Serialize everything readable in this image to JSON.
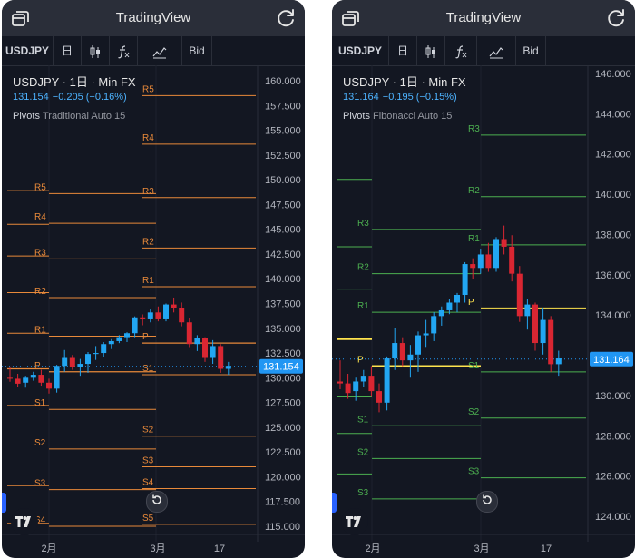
{
  "app": {
    "title": "TradingView"
  },
  "toolbar": {
    "symbol": "USDJPY",
    "interval": "日",
    "price_type": "Bid"
  },
  "colors": {
    "up": "#22a6f2",
    "down": "#d92632",
    "pivot_orange": "#e8893a",
    "pivot_green": "#4caf50",
    "pivot_yellow": "#ffe44d",
    "price_tag": "#2196f3",
    "bg": "#131722"
  },
  "icons": {
    "left": "window-switch-icon",
    "right": "refresh-icon",
    "candles": "candlestick-icon",
    "indicators": "function-fx-icon",
    "compare": "chart-line-icon"
  },
  "charts": [
    {
      "legend": {
        "symbol_line": "USDJPY · 1日 · Min FX",
        "price": "131.154",
        "change": "−0.205 (−0.16%)",
        "indicator_name": "Pivots",
        "indicator_args": "Traditional Auto 15"
      },
      "price_axis": {
        "ticks": [
          "160.000",
          "157.500",
          "155.000",
          "152.500",
          "150.000",
          "147.500",
          "145.000",
          "142.500",
          "140.000",
          "137.500",
          "135.000",
          "132.500",
          "130.000",
          "127.500",
          "125.000",
          "122.500",
          "120.000",
          "117.500",
          "115.000"
        ],
        "current_price": "131.154"
      },
      "time_axis": [
        "2月",
        "3月",
        "17"
      ],
      "pivot_labels": [
        "R5",
        "R4",
        "R3",
        "R2",
        "R1",
        "P",
        "S1",
        "S2",
        "S3",
        "S4",
        "S5"
      ],
      "ohlc": [
        {
          "o": 130.0,
          "h": 131.1,
          "l": 129.6,
          "c": 129.9
        },
        {
          "o": 129.9,
          "h": 130.4,
          "l": 129.1,
          "c": 129.4
        },
        {
          "o": 129.5,
          "h": 130.2,
          "l": 129.0,
          "c": 130.0
        },
        {
          "o": 130.0,
          "h": 130.6,
          "l": 129.7,
          "c": 130.3
        },
        {
          "o": 130.3,
          "h": 130.8,
          "l": 129.2,
          "c": 129.5
        },
        {
          "o": 129.5,
          "h": 129.9,
          "l": 128.4,
          "c": 128.9
        },
        {
          "o": 128.9,
          "h": 131.3,
          "l": 128.5,
          "c": 131.2
        },
        {
          "o": 131.2,
          "h": 132.8,
          "l": 130.6,
          "c": 132.0
        },
        {
          "o": 132.0,
          "h": 132.3,
          "l": 130.8,
          "c": 131.1
        },
        {
          "o": 131.1,
          "h": 131.9,
          "l": 130.2,
          "c": 131.4
        },
        {
          "o": 131.4,
          "h": 132.6,
          "l": 130.5,
          "c": 132.4
        },
        {
          "o": 132.4,
          "h": 133.2,
          "l": 131.8,
          "c": 132.5
        },
        {
          "o": 132.5,
          "h": 133.6,
          "l": 132.1,
          "c": 133.4
        },
        {
          "o": 133.4,
          "h": 133.9,
          "l": 132.9,
          "c": 133.7
        },
        {
          "o": 133.7,
          "h": 134.3,
          "l": 133.5,
          "c": 134.1
        },
        {
          "o": 134.1,
          "h": 134.6,
          "l": 133.6,
          "c": 134.5
        },
        {
          "o": 134.5,
          "h": 136.2,
          "l": 134.1,
          "c": 136.1
        },
        {
          "o": 136.1,
          "h": 136.4,
          "l": 135.3,
          "c": 135.9
        },
        {
          "o": 135.9,
          "h": 136.9,
          "l": 135.6,
          "c": 136.6
        },
        {
          "o": 136.6,
          "h": 137.2,
          "l": 135.7,
          "c": 135.9
        },
        {
          "o": 135.9,
          "h": 137.5,
          "l": 135.7,
          "c": 137.4
        },
        {
          "o": 137.4,
          "h": 138.1,
          "l": 136.6,
          "c": 137.0
        },
        {
          "o": 137.0,
          "h": 137.6,
          "l": 135.2,
          "c": 135.6
        },
        {
          "o": 135.6,
          "h": 136.0,
          "l": 133.1,
          "c": 133.4
        },
        {
          "o": 133.4,
          "h": 134.3,
          "l": 132.7,
          "c": 134.0
        },
        {
          "o": 134.0,
          "h": 134.1,
          "l": 131.6,
          "c": 132.0
        },
        {
          "o": 132.0,
          "h": 133.8,
          "l": 131.4,
          "c": 133.2
        },
        {
          "o": 133.2,
          "h": 133.4,
          "l": 130.5,
          "c": 130.9
        },
        {
          "o": 130.9,
          "h": 131.6,
          "l": 130.3,
          "c": 131.2
        }
      ]
    },
    {
      "legend": {
        "symbol_line": "USDJPY · 1日 · Min FX",
        "price": "131.164",
        "change": "−0.195 (−0.15%)",
        "indicator_name": "Pivots",
        "indicator_args": "Fibonacci Auto 15"
      },
      "price_axis": {
        "ticks": [
          "146.000",
          "144.000",
          "142.000",
          "140.000",
          "138.000",
          "136.000",
          "134.000",
          "132.000",
          "130.000",
          "128.000",
          "126.000",
          "124.000"
        ],
        "current_price": "131.164"
      },
      "time_axis": [
        "2月",
        "3月",
        "17"
      ],
      "pivot_labels": [
        "R3",
        "R2",
        "R1",
        "P",
        "S1",
        "S2",
        "S3"
      ],
      "ohlc": [
        {
          "o": 130.0,
          "h": 131.1,
          "l": 129.6,
          "c": 129.9
        },
        {
          "o": 129.9,
          "h": 130.4,
          "l": 129.1,
          "c": 129.4
        },
        {
          "o": 129.5,
          "h": 130.2,
          "l": 129.0,
          "c": 130.0
        },
        {
          "o": 130.0,
          "h": 130.6,
          "l": 129.7,
          "c": 130.3
        },
        {
          "o": 130.3,
          "h": 130.8,
          "l": 129.2,
          "c": 129.5
        },
        {
          "o": 129.5,
          "h": 129.9,
          "l": 128.4,
          "c": 128.9
        },
        {
          "o": 128.9,
          "h": 131.3,
          "l": 128.5,
          "c": 131.2
        },
        {
          "o": 131.2,
          "h": 132.8,
          "l": 130.6,
          "c": 132.0
        },
        {
          "o": 132.0,
          "h": 132.3,
          "l": 130.8,
          "c": 131.1
        },
        {
          "o": 131.1,
          "h": 131.9,
          "l": 130.2,
          "c": 131.4
        },
        {
          "o": 131.4,
          "h": 132.6,
          "l": 130.5,
          "c": 132.4
        },
        {
          "o": 132.4,
          "h": 133.2,
          "l": 131.8,
          "c": 132.5
        },
        {
          "o": 132.5,
          "h": 133.6,
          "l": 132.1,
          "c": 133.4
        },
        {
          "o": 133.4,
          "h": 133.9,
          "l": 132.9,
          "c": 133.7
        },
        {
          "o": 133.7,
          "h": 134.3,
          "l": 133.5,
          "c": 134.1
        },
        {
          "o": 134.1,
          "h": 134.6,
          "l": 133.6,
          "c": 134.5
        },
        {
          "o": 134.5,
          "h": 136.2,
          "l": 134.1,
          "c": 136.1
        },
        {
          "o": 136.1,
          "h": 136.4,
          "l": 135.3,
          "c": 135.9
        },
        {
          "o": 135.9,
          "h": 136.9,
          "l": 135.6,
          "c": 136.6
        },
        {
          "o": 136.6,
          "h": 137.2,
          "l": 135.7,
          "c": 135.9
        },
        {
          "o": 135.9,
          "h": 137.5,
          "l": 135.7,
          "c": 137.4
        },
        {
          "o": 137.4,
          "h": 138.1,
          "l": 136.6,
          "c": 137.0
        },
        {
          "o": 137.0,
          "h": 137.6,
          "l": 135.2,
          "c": 135.6
        },
        {
          "o": 135.6,
          "h": 136.0,
          "l": 133.1,
          "c": 133.4
        },
        {
          "o": 133.4,
          "h": 134.3,
          "l": 132.7,
          "c": 134.0
        },
        {
          "o": 134.0,
          "h": 134.1,
          "l": 131.6,
          "c": 132.0
        },
        {
          "o": 132.0,
          "h": 133.8,
          "l": 131.4,
          "c": 133.2
        },
        {
          "o": 133.2,
          "h": 133.4,
          "l": 130.5,
          "c": 130.9
        },
        {
          "o": 130.9,
          "h": 131.6,
          "l": 130.3,
          "c": 131.2
        }
      ]
    }
  ]
}
